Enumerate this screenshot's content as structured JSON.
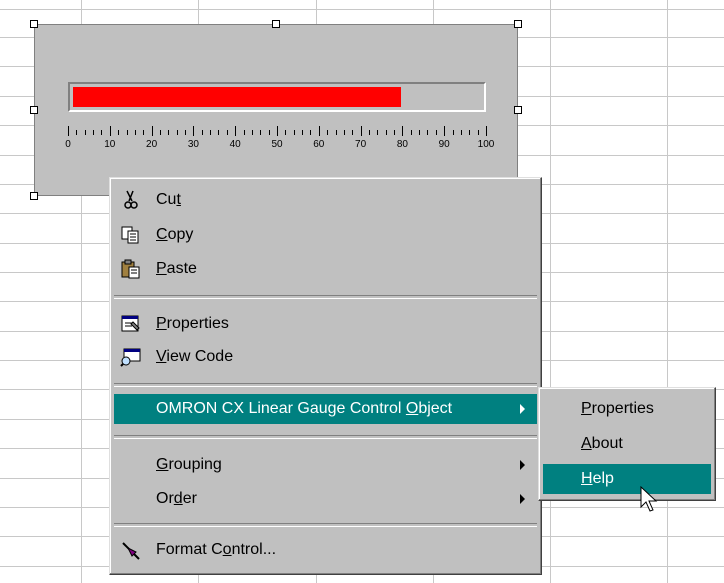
{
  "gauge": {
    "value": 80,
    "min": 0,
    "max": 100,
    "fill_color": "#ff0000",
    "scale_labels": [
      "0",
      "10",
      "20",
      "30",
      "40",
      "50",
      "60",
      "70",
      "80",
      "90",
      "100"
    ]
  },
  "context_menu": {
    "items": [
      {
        "label_pre": "Cu",
        "label_u": "t",
        "label_post": "",
        "icon": "scissors-icon"
      },
      {
        "label_pre": "",
        "label_u": "C",
        "label_post": "opy",
        "icon": "copy-icon"
      },
      {
        "label_pre": "",
        "label_u": "P",
        "label_post": "aste",
        "icon": "paste-icon"
      },
      {
        "label_pre": "",
        "label_u": "P",
        "label_post": "roperties",
        "icon": "properties-icon"
      },
      {
        "label_pre": "",
        "label_u": "V",
        "label_post": "iew Code",
        "icon": "view-code-icon"
      },
      {
        "label_pre": "OMRON CX Linear Gauge Control ",
        "label_u": "O",
        "label_post": "bject"
      },
      {
        "label_pre": "",
        "label_u": "G",
        "label_post": "rouping"
      },
      {
        "label_pre": "Or",
        "label_u": "d",
        "label_post": "er"
      },
      {
        "label_pre": "Format C",
        "label_u": "o",
        "label_post": "ntrol...",
        "icon": "format-control-icon"
      }
    ]
  },
  "submenu": {
    "items": [
      {
        "label_pre": "",
        "label_u": "P",
        "label_post": "roperties"
      },
      {
        "label_pre": "",
        "label_u": "A",
        "label_post": "bout"
      },
      {
        "label_pre": "",
        "label_u": "H",
        "label_post": "elp"
      }
    ]
  },
  "colors": {
    "highlight": "#008080",
    "menu_face": "#c0c0c0",
    "grid_line": "#c8c8c8"
  }
}
